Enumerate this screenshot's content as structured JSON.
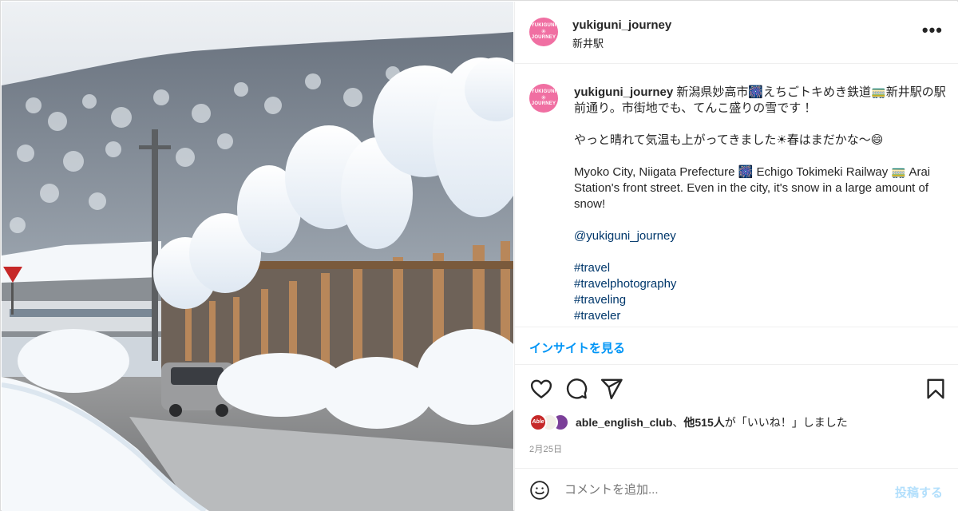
{
  "colors": {
    "brand_avatar": "#f06fa2",
    "link": "#00376b",
    "primary": "#0095f6",
    "post_disabled": "#b2dffc",
    "muted": "#8e8e8e"
  },
  "avatar": {
    "line1": "YUKIGUNI",
    "line2": "JOURNEY",
    "glyph": "✳"
  },
  "header": {
    "username": "yukiguni_journey",
    "location": "新井駅",
    "more_icon": "more-horizontal-icon",
    "more_label": "•••"
  },
  "caption": {
    "username": "yukiguni_journey",
    "jp_line1": "新潟県妙高市🎆えちごトキめき鉄道🚃新井駅の駅前通り。市街地でも、てんこ盛りの雪です ！",
    "jp_line2": "やっと晴れて気温も上がってきました☀春はまだかな～😄",
    "en_text": "Myoko City, Niigata Prefecture 🎆 Echigo Tokimeki Railway 🚃 Arai Station's front street. Even in the city, it's snow in a large amount of snow!",
    "mention": "@yukiguni_journey",
    "hashtags": [
      "#travel",
      "#travelphotography",
      "#traveling",
      "#traveler"
    ]
  },
  "insights_label": "インサイトを見る",
  "actions": {
    "like_icon": "heart-icon",
    "comment_icon": "comment-icon",
    "share_icon": "paper-plane-icon",
    "save_icon": "bookmark-icon"
  },
  "likes": {
    "avatar1_text": "Able",
    "user": "able_english_club",
    "sep": "、",
    "others": "他515人",
    "suffix": "が「いいね！」しました"
  },
  "date": "2月25日",
  "comment": {
    "emoji_icon": "smiley-icon",
    "placeholder": "コメントを追加...",
    "post_label": "投稿する"
  }
}
